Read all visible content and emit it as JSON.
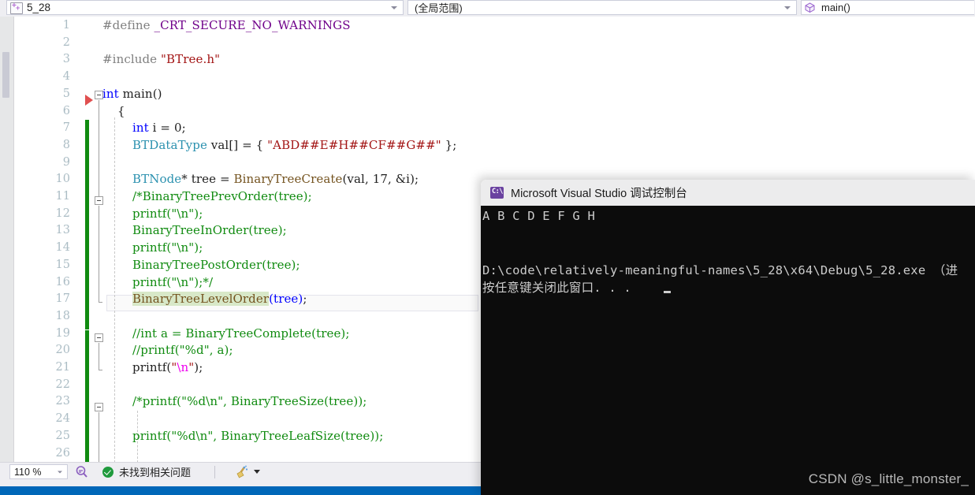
{
  "navbar": {
    "file_combo": {
      "value": "5_28",
      "icon": "cpp-file-icon"
    },
    "scope_combo": {
      "value": "(全局范围)"
    },
    "member_combo": {
      "value": "main()",
      "icon": "cube-icon"
    }
  },
  "editor": {
    "zoom_level": "110 %",
    "status_message": "未找到相关问题",
    "line_numbers": [
      "1",
      "2",
      "3",
      "4",
      "5",
      "6",
      "7",
      "8",
      "9",
      "10",
      "11",
      "12",
      "13",
      "14",
      "15",
      "16",
      "17",
      "18",
      "19",
      "20",
      "21",
      "22",
      "23",
      "24",
      "25",
      "26"
    ],
    "current_line": 17,
    "breakpoint_marker_line": 5,
    "code_lines": [
      {
        "n": 1,
        "indent": 0,
        "tokens": [
          {
            "t": "#define ",
            "c": "pp"
          },
          {
            "t": "_CRT_SECURE_NO_WARNINGS",
            "c": "mac"
          }
        ]
      },
      {
        "n": 2,
        "indent": 0,
        "tokens": []
      },
      {
        "n": 3,
        "indent": 0,
        "tokens": [
          {
            "t": "#include ",
            "c": "pp"
          },
          {
            "t": "\"BTree.h\"",
            "c": "str"
          }
        ]
      },
      {
        "n": 4,
        "indent": 0,
        "tokens": []
      },
      {
        "n": 5,
        "indent": 0,
        "tokens": [
          {
            "t": "int",
            "c": "kw"
          },
          {
            "t": " main()",
            "c": "plain"
          }
        ]
      },
      {
        "n": 6,
        "indent": 1,
        "tokens": [
          {
            "t": "{",
            "c": "plain"
          }
        ]
      },
      {
        "n": 7,
        "indent": 2,
        "tokens": [
          {
            "t": "int",
            "c": "kw"
          },
          {
            "t": " i = ",
            "c": "plain"
          },
          {
            "t": "0",
            "c": "num"
          },
          {
            "t": ";",
            "c": "plain"
          }
        ]
      },
      {
        "n": 8,
        "indent": 2,
        "tokens": [
          {
            "t": "BTDataType",
            "c": "type"
          },
          {
            "t": " val[] = { ",
            "c": "plain"
          },
          {
            "t": "\"ABD##E#H##CF##G##\"",
            "c": "str"
          },
          {
            "t": " };",
            "c": "plain"
          }
        ]
      },
      {
        "n": 9,
        "indent": 2,
        "tokens": []
      },
      {
        "n": 10,
        "indent": 2,
        "tokens": [
          {
            "t": "BTNode",
            "c": "type"
          },
          {
            "t": "* tree = ",
            "c": "plain"
          },
          {
            "t": "BinaryTreeCreate",
            "c": "fn"
          },
          {
            "t": "(val, ",
            "c": "plain"
          },
          {
            "t": "17",
            "c": "num"
          },
          {
            "t": ", &i);",
            "c": "plain"
          }
        ]
      },
      {
        "n": 11,
        "indent": 2,
        "tokens": [
          {
            "t": "/*BinaryTreePrevOrder(tree);",
            "c": "cmt"
          }
        ]
      },
      {
        "n": 12,
        "indent": 2,
        "tokens": [
          {
            "t": "printf(\"\\n\");",
            "c": "cmt"
          }
        ]
      },
      {
        "n": 13,
        "indent": 2,
        "tokens": [
          {
            "t": "BinaryTreeInOrder(tree);",
            "c": "cmt"
          }
        ]
      },
      {
        "n": 14,
        "indent": 2,
        "tokens": [
          {
            "t": "printf(\"\\n\");",
            "c": "cmt"
          }
        ]
      },
      {
        "n": 15,
        "indent": 2,
        "tokens": [
          {
            "t": "BinaryTreePostOrder(tree);",
            "c": "cmt"
          }
        ]
      },
      {
        "n": 16,
        "indent": 2,
        "tokens": [
          {
            "t": "printf(\"\\n\");*/",
            "c": "cmt"
          }
        ]
      },
      {
        "n": 17,
        "indent": 2,
        "tokens": [
          {
            "t": "BinaryTreeLevelOrder",
            "c": "fn hl"
          },
          {
            "t": "(tree)",
            "c": "kw"
          },
          {
            "t": ";",
            "c": "plain"
          }
        ]
      },
      {
        "n": 18,
        "indent": 2,
        "tokens": []
      },
      {
        "n": 19,
        "indent": 2,
        "tokens": [
          {
            "t": "//int a = BinaryTreeComplete(tree);",
            "c": "cmt"
          }
        ]
      },
      {
        "n": 20,
        "indent": 2,
        "tokens": [
          {
            "t": "//printf(\"%d\", a);",
            "c": "cmt"
          }
        ]
      },
      {
        "n": 21,
        "indent": 2,
        "tokens": [
          {
            "t": "printf(",
            "c": "plain"
          },
          {
            "t": "\"",
            "c": "str"
          },
          {
            "t": "\\n",
            "c": "esc"
          },
          {
            "t": "\"",
            "c": "str"
          },
          {
            "t": ");",
            "c": "plain"
          }
        ]
      },
      {
        "n": 22,
        "indent": 2,
        "tokens": []
      },
      {
        "n": 23,
        "indent": 2,
        "tokens": [
          {
            "t": "/*printf(\"%d\\n\", BinaryTreeSize(tree));",
            "c": "cmt"
          }
        ]
      },
      {
        "n": 24,
        "indent": 2,
        "tokens": []
      },
      {
        "n": 25,
        "indent": 2,
        "tokens": [
          {
            "t": "printf(\"%d\\n\", BinaryTreeLeafSize(tree));",
            "c": "cmt"
          }
        ]
      },
      {
        "n": 26,
        "indent": 2,
        "tokens": []
      }
    ]
  },
  "console": {
    "title": "Microsoft Visual Studio 调试控制台",
    "icon": "console-window-icon",
    "output_lines": [
      "A B C D E F G H",
      "",
      "",
      "D:\\code\\relatively-meaningful-names\\5_28\\x64\\Debug\\5_28.exe （进",
      "按任意键关闭此窗口. . ."
    ]
  },
  "watermark": {
    "text": "CSDN @s_little_monster_"
  },
  "colors": {
    "keyword": "#0000ff",
    "comment": "#108b10",
    "string": "#a31515",
    "type": "#2b91af",
    "function": "#74531f",
    "macro": "#6f008a",
    "changebar": "#108b10",
    "accent_blue": "#0067b8",
    "status_ok": "#1f9a3d",
    "console_bg": "#0c0c0c"
  }
}
